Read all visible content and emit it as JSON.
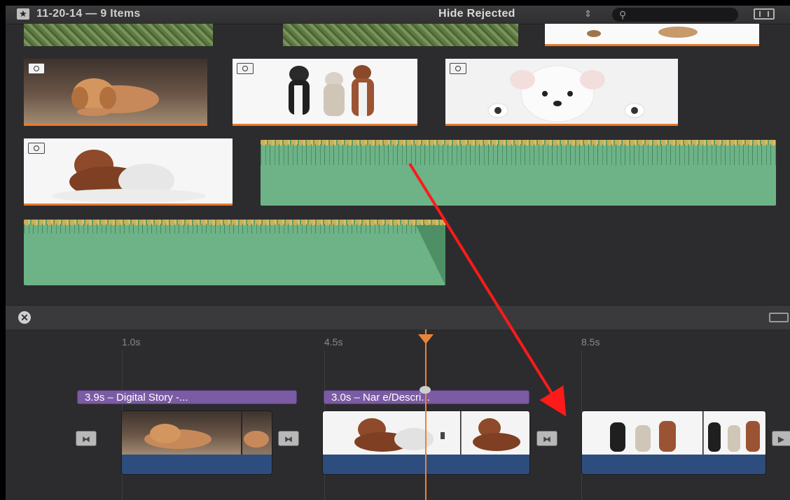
{
  "header": {
    "event_title": "11-20-14 — 9 Items",
    "filter_label": "Hide Rejected",
    "search_placeholder": ""
  },
  "browser": {
    "clips": [
      {
        "kind": "video",
        "subject": "grass"
      },
      {
        "kind": "video",
        "subject": "grass"
      },
      {
        "kind": "photo",
        "subject": "dog on white"
      },
      {
        "kind": "photo",
        "subject": "puppy lying on floor"
      },
      {
        "kind": "photo",
        "subject": "three dogs sitting"
      },
      {
        "kind": "photo",
        "subject": "white puppy peeking"
      },
      {
        "kind": "photo",
        "subject": "wrinkled puppy with blanket"
      },
      {
        "kind": "audio"
      },
      {
        "kind": "audio"
      }
    ]
  },
  "timeline": {
    "ruler": [
      {
        "label": "1.0s"
      },
      {
        "label": "4.5s"
      },
      {
        "label": "8.5s"
      }
    ],
    "titles": [
      {
        "text": "3.9s – Digital Story -..."
      },
      {
        "text": "3.0s – Nar e/Descri..."
      }
    ]
  },
  "colors": {
    "accent_orange": "#e8792e",
    "title_purple": "#7b5ba3",
    "track_blue": "#2e4d7f",
    "audio_green": "#6db387",
    "annotation_red": "#ff1a1a"
  },
  "icons": [
    "star-icon",
    "search-icon",
    "filmstrip-icon",
    "camera-icon",
    "close-circle-icon",
    "transition-icon"
  ]
}
